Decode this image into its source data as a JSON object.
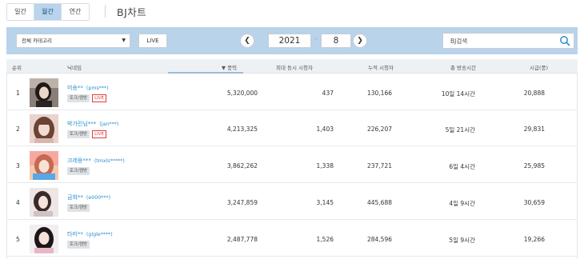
{
  "period_tabs": [
    {
      "label": "일간",
      "active": false
    },
    {
      "label": "월간",
      "active": true
    },
    {
      "label": "연간",
      "active": false
    }
  ],
  "page_title": "BJ차트",
  "filters": {
    "category": "전체 카테고리",
    "live_label": "LIVE",
    "year": "2021",
    "month": "8",
    "search_placeholder": "BJ검색"
  },
  "table": {
    "headers": {
      "rank": "순위",
      "nickname": "닉네임",
      "balloons": "▼ 풍력",
      "max_viewers": "최대 동시 시청자",
      "acc_viewers": "누적 시청자",
      "total_time": "총 방송시간",
      "cash": "시급(풍)"
    },
    "rows": [
      {
        "rank": "1",
        "name": "미숑**",
        "id": "(pms***)",
        "tags": [
          "토크/캠방"
        ],
        "live": "LIVE",
        "balloons": "5,320,000",
        "max_viewers": "437",
        "acc_viewers": "130,166",
        "total_time": "10일 14시간",
        "cash": "20,888"
      },
      {
        "rank": "2",
        "name": "박가린님***",
        "id": "(jan***)",
        "tags": [
          "토크/캠방"
        ],
        "live": "LIVE",
        "balloons": "4,213,325",
        "max_viewers": "1,403",
        "acc_viewers": "226,207",
        "total_time": "5일 21시간",
        "cash": "29,831"
      },
      {
        "rank": "3",
        "name": "크레용***",
        "id": "(tmxls*****)",
        "tags": [
          "토크/캠방"
        ],
        "live": "",
        "balloons": "3,862,262",
        "max_viewers": "1,338",
        "acc_viewers": "237,721",
        "total_time": "6일 4시간",
        "cash": "25,985"
      },
      {
        "rank": "4",
        "name": "금화**",
        "id": "(e000***)",
        "tags": [
          "토크/캠방"
        ],
        "live": "",
        "balloons": "3,247,859",
        "max_viewers": "3,145",
        "acc_viewers": "445,688",
        "total_time": "4일 9시간",
        "cash": "30,659"
      },
      {
        "rank": "5",
        "name": "타미**",
        "id": "(glgle****)",
        "tags": [
          "토크/캠방"
        ],
        "live": "",
        "balloons": "2,487,778",
        "max_viewers": "1,526",
        "acc_viewers": "284,596",
        "total_time": "5일 9시간",
        "cash": "19,266"
      }
    ]
  },
  "colors": {
    "accent_band": "#b8d3ea",
    "link": "#2a8fd0",
    "live": "#e03c3c"
  }
}
